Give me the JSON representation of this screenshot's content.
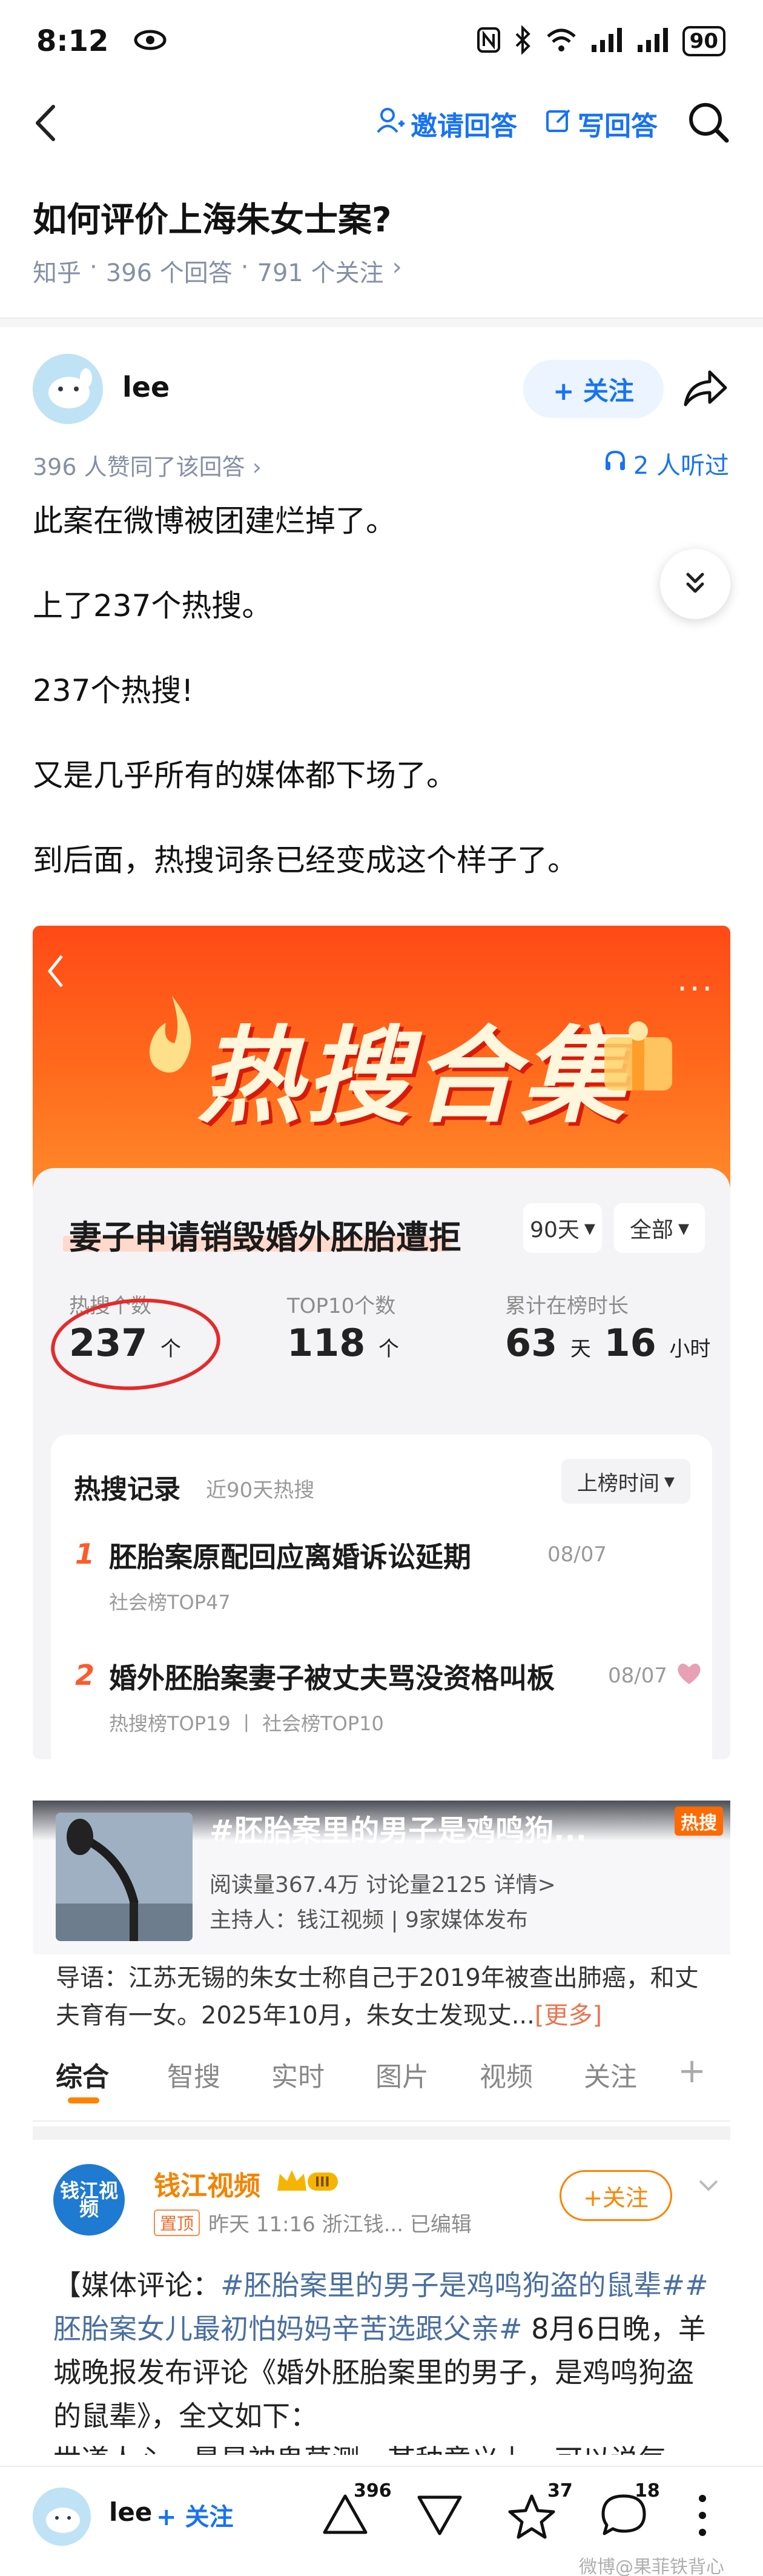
{
  "status_bar": {
    "time": "8:12",
    "battery": "90"
  },
  "nav": {
    "invite_label": "邀请回答",
    "write_label": "写回答"
  },
  "question": {
    "title": "如何评价上海朱女士案?",
    "site": "知乎",
    "answers": "396 个回答",
    "followers": "791 个关注",
    "chevron": "›"
  },
  "author": {
    "name": "lee",
    "follow_label": "+ 关注"
  },
  "answer_meta": {
    "votes": "396 人赞同了该回答 ›",
    "listen": "2 人听过"
  },
  "answer": {
    "paragraphs": [
      "此案在微博被团建烂掉了。",
      "上了237个热搜。",
      "237个热搜!",
      "又是几乎所有的媒体都下场了。",
      "到后面，热搜词条已经变成这个样子了。"
    ]
  },
  "shot1": {
    "banner_title": "热搜合集",
    "banner_dots": "...",
    "topic": "妻子申请销毁婚外胚胎遭拒",
    "period_chip": "90天",
    "scope_chip": "全部",
    "stats": [
      {
        "label": "热搜个数",
        "value": "237",
        "unit": "个"
      },
      {
        "label": "TOP10个数",
        "value": "118",
        "unit": "个"
      },
      {
        "label": "累计在榜时长",
        "value": "63",
        "unit": "天",
        "value2": "16",
        "unit2": "小时"
      }
    ],
    "record_title": "热搜记录",
    "record_sub": "近90天热搜",
    "record_sort": "上榜时间",
    "records": [
      {
        "rank": "1",
        "text": "胚胎案原配回应离婚诉讼延期",
        "date": "08/07",
        "tag": "社会榜TOP47"
      },
      {
        "rank": "2",
        "text": "婚外胚胎案妻子被丈夫骂没资格叫板",
        "date": "08/07",
        "tag": "热搜榜TOP19 丨 社会榜TOP10"
      }
    ]
  },
  "shot2": {
    "hero_title": "#胚胎案里的男子是鸡鸣狗...",
    "hot_badge": "热搜",
    "hero_stats": "阅读量367.4万  讨论量2125  详情>",
    "hero_host": "主持人：钱江视频 | 9家媒体发布",
    "guide_text": "导语：江苏无锡的朱女士称自己于2019年被查出肺癌，和丈夫育有一女。2025年10月，朱女士发现丈...",
    "guide_more": "[更多]",
    "tabs": [
      "综合",
      "智搜",
      "实时",
      "图片",
      "视频",
      "关注"
    ],
    "tab_plus": "+",
    "post_name": "钱江视频",
    "post_avatar_text": "钱江视频",
    "post_pin": "置顶",
    "post_meta": "昨天 11:16  浙江钱... 已编辑",
    "post_follow": "+关注",
    "post_body_prefix": "【媒体评论：",
    "post_topic1": "#胚胎案里的男子是鸡鸣狗盗的鼠辈#",
    "post_topic2": "#胚胎案女儿最初怕妈妈辛苦选跟父亲#",
    "post_body_rest": " 8月6日晚，羊城晚报发布评论《婚外胚胎案里的男子，是鸡鸣狗盗的鼠辈》，全文如下：",
    "post_body_last": "世道人心，最是神鬼莫测。某种意义上，可以说每"
  },
  "bottom_bar": {
    "name": "lee",
    "follow": "+ 关注",
    "upvotes": "396",
    "favorites": "37",
    "comments": "18",
    "watermark": "微博@果菲铁背心"
  },
  "colors": {
    "zhihu_blue": "#1772f6",
    "weibo_orange": "#ff8200",
    "hot_red": "#ff4a16"
  },
  "icons": [
    "eye-icon",
    "nfc-icon",
    "bluetooth-icon",
    "wifi-icon",
    "signal-icon",
    "back-icon",
    "person-plus-icon",
    "edit-icon",
    "search-icon",
    "share-icon",
    "headphone-icon",
    "chevrons-down-icon",
    "upvote-icon",
    "downvote-icon",
    "star-icon",
    "comment-icon",
    "more-icon"
  ]
}
